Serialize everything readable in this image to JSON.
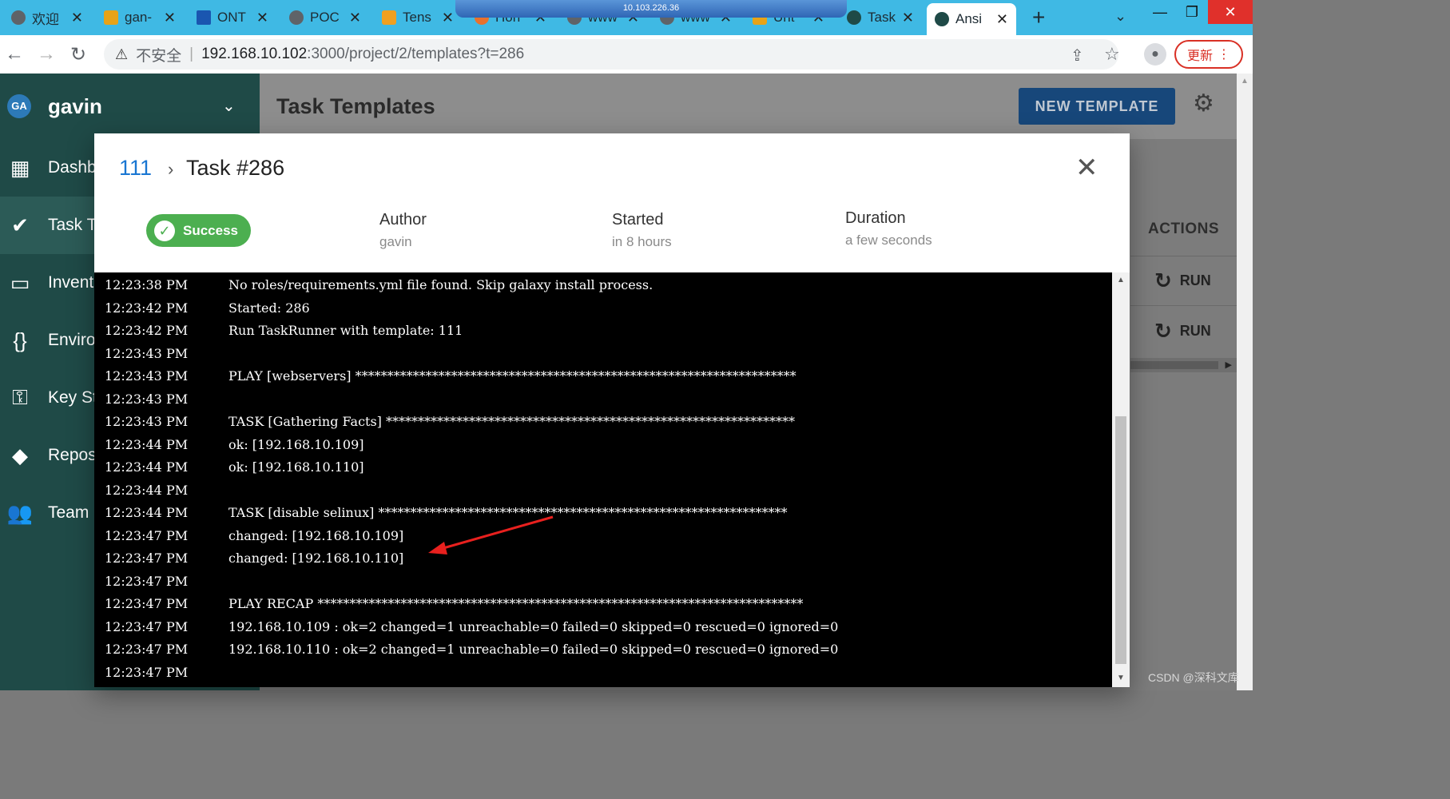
{
  "browser": {
    "tabs": [
      {
        "label": "欢迎",
        "icon_color": "#5f6368"
      },
      {
        "label": "gan-",
        "icon_color": "#e8a317"
      },
      {
        "label": "ONT",
        "icon_color": "#1a56b0"
      },
      {
        "label": "POC",
        "icon_color": "#5f6368"
      },
      {
        "label": "Tens",
        "icon_color": "#f0a020"
      },
      {
        "label": "Hon",
        "icon_color": "#e8712d"
      },
      {
        "label": "www",
        "icon_color": "#5f6368"
      },
      {
        "label": "www",
        "icon_color": "#5f6368"
      },
      {
        "label": "Unt",
        "icon_color": "#e8a317"
      },
      {
        "label": "Task",
        "icon_color": "#1f4a47"
      },
      {
        "label": "Ansi",
        "icon_color": "#1f4a47"
      }
    ],
    "remote_desktop_ip": "10.103.226.36",
    "security_label": "不安全",
    "url_host": "192.168.10.102",
    "url_path": ":3000/project/2/templates?t=286",
    "update_label": "更新"
  },
  "sidebar": {
    "avatar_initials": "GA",
    "account_name": "gavin",
    "items": [
      {
        "label": "Dashb",
        "icon": "dashboard-icon"
      },
      {
        "label": "Task T",
        "icon": "checkmarks-icon"
      },
      {
        "label": "Invent",
        "icon": "monitor-icon"
      },
      {
        "label": "Enviro",
        "icon": "braces-icon"
      },
      {
        "label": "Key St",
        "icon": "key-icon"
      },
      {
        "label": "Repos",
        "icon": "git-icon"
      },
      {
        "label": "Team",
        "icon": "people-icon"
      }
    ]
  },
  "header": {
    "title": "Task Templates",
    "new_template_label": "NEW TEMPLATE"
  },
  "table": {
    "actions_header": "ACTIONS",
    "run_label": "RUN"
  },
  "dialog": {
    "breadcrumb_link": "111",
    "title": "Task #286",
    "status": "Success",
    "meta": [
      {
        "label": "Author",
        "value": "gavin"
      },
      {
        "label": "Started",
        "value": "in 8 hours"
      },
      {
        "label": "Duration",
        "value": "a few seconds"
      }
    ],
    "log": [
      {
        "time": "12:23:38 PM",
        "msg": "No roles/requirements.yml file found. Skip galaxy install process."
      },
      {
        "time": "12:23:42 PM",
        "msg": "Started: 286"
      },
      {
        "time": "12:23:42 PM",
        "msg": "Run TaskRunner with template: 111"
      },
      {
        "time": "12:23:43 PM",
        "msg": ""
      },
      {
        "time": "12:23:43 PM",
        "msg": "PLAY [webservers] *********************************************************************"
      },
      {
        "time": "12:23:43 PM",
        "msg": ""
      },
      {
        "time": "12:23:43 PM",
        "msg": "TASK [Gathering Facts] ****************************************************************"
      },
      {
        "time": "12:23:44 PM",
        "msg": "ok: [192.168.10.109]"
      },
      {
        "time": "12:23:44 PM",
        "msg": "ok: [192.168.10.110]"
      },
      {
        "time": "12:23:44 PM",
        "msg": ""
      },
      {
        "time": "12:23:44 PM",
        "msg": "TASK [disable selinux] ****************************************************************"
      },
      {
        "time": "12:23:47 PM",
        "msg": "changed: [192.168.10.109]"
      },
      {
        "time": "12:23:47 PM",
        "msg": "changed: [192.168.10.110]"
      },
      {
        "time": "12:23:47 PM",
        "msg": ""
      },
      {
        "time": "12:23:47 PM",
        "msg": "PLAY RECAP ****************************************************************************"
      },
      {
        "time": "12:23:47 PM",
        "msg": "192.168.10.109 : ok=2 changed=1 unreachable=0 failed=0 skipped=0 rescued=0 ignored=0"
      },
      {
        "time": "12:23:47 PM",
        "msg": "192.168.10.110 : ok=2 changed=1 unreachable=0 failed=0 skipped=0 rescued=0 ignored=0"
      },
      {
        "time": "12:23:47 PM",
        "msg": ""
      }
    ]
  },
  "watermark": "CSDN @深科文库",
  "colors": {
    "tabbar": "#3fb9e4",
    "sidebar": "#1f4a47",
    "success": "#4caf50",
    "link": "#1976d2",
    "annotation_arrow": "#e8201e"
  }
}
